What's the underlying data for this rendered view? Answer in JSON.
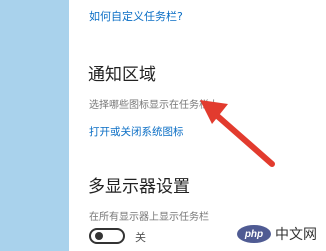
{
  "settings": {
    "customize_taskbar_link": "如何自定义任务栏?",
    "notification_area": {
      "heading": "通知区域",
      "select_icons_desc": "选择哪些图标显示在任务栏上",
      "system_icons_link": "打开或关闭系统图标"
    },
    "multi_display": {
      "heading": "多显示器设置",
      "show_taskbar_desc": "在所有显示器上显示任务栏",
      "toggle_state_label": "关",
      "toggle_on": false
    }
  },
  "watermark": {
    "logo_text": "php",
    "site_text": "中文网"
  },
  "colors": {
    "left_pane": "#a9d2ec",
    "link": "#0a6ec5",
    "arrow": "#e23b2e"
  }
}
